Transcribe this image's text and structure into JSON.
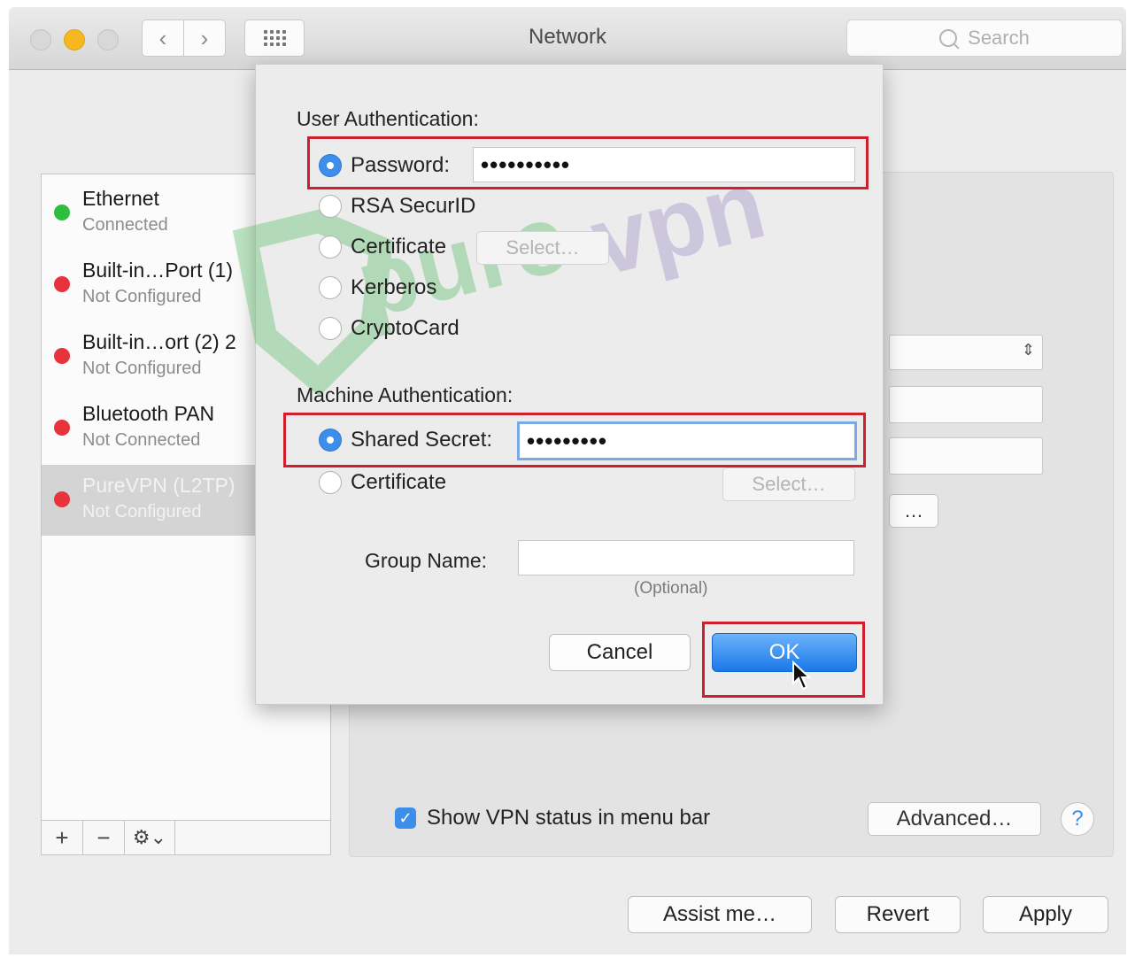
{
  "window": {
    "title": "Network",
    "search_placeholder": "Search"
  },
  "sidebar": {
    "services": [
      {
        "name": "Ethernet",
        "status": "Connected",
        "status_color": "#2dbe3c"
      },
      {
        "name": "Built-in…Port (1)",
        "status": "Not Configured",
        "status_color": "#e8323c"
      },
      {
        "name": "Built-in…ort (2) 2",
        "status": "Not Configured",
        "status_color": "#e8323c"
      },
      {
        "name": "Bluetooth PAN",
        "status": "Not Connected",
        "status_color": "#e8323c"
      },
      {
        "name": "PureVPN (L2TP)",
        "status": "Not Configured",
        "status_color": "#e8323c",
        "selected": true
      }
    ],
    "toolbar": {
      "add": "+",
      "remove": "−",
      "gear": "⚙⌄"
    }
  },
  "content": {
    "partial_button_label": "…",
    "show_vpn_status_checked": true,
    "show_vpn_status_label": "Show VPN status in menu bar",
    "advanced_label": "Advanced…",
    "help_label": "?"
  },
  "bottom": {
    "assist_label": "Assist me…",
    "revert_label": "Revert",
    "apply_label": "Apply"
  },
  "sheet": {
    "user_auth_label": "User Authentication:",
    "user_auth_options": [
      {
        "label": "Password:",
        "selected": true
      },
      {
        "label": "RSA SecurID",
        "selected": false
      },
      {
        "label": "Certificate",
        "selected": false
      },
      {
        "label": "Kerberos",
        "selected": false
      },
      {
        "label": "CryptoCard",
        "selected": false
      }
    ],
    "password_value": "••••••••••",
    "certificate_select_label": "Select…",
    "machine_auth_label": "Machine Authentication:",
    "machine_auth_options": [
      {
        "label": "Shared Secret:",
        "selected": true
      },
      {
        "label": "Certificate",
        "selected": false
      }
    ],
    "shared_secret_value": "•••••••••",
    "machine_cert_select_label": "Select…",
    "group_name_label": "Group Name:",
    "group_name_value": "",
    "group_name_hint": "(Optional)",
    "cancel_label": "Cancel",
    "ok_label": "OK"
  },
  "watermark": {
    "text": "purevpn",
    "accent": "#3cb44b",
    "secondary": "#8e7cc3"
  },
  "colors": {
    "accent": "#3d8ee8",
    "highlight": "#d0202e"
  }
}
